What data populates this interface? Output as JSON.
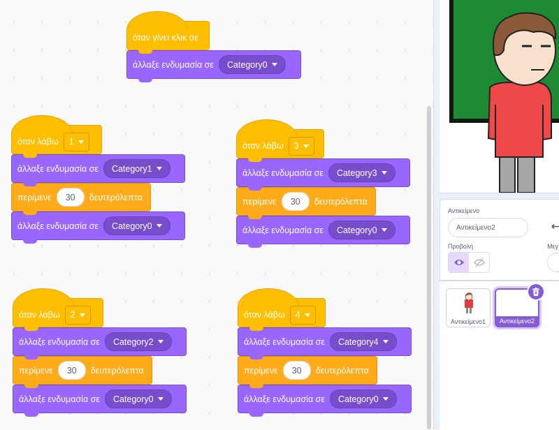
{
  "workspace": {
    "scripts": [
      {
        "hat": "όταν γίνει κλικ σε",
        "change_costume": "άλλαξε ενδυμασία σε",
        "costume": "Category0"
      },
      {
        "hat": "όταν λάβω",
        "message": "1",
        "change1": "άλλαξε ενδυμασία σε",
        "costume1": "Category1",
        "wait": "περίμενε",
        "seconds": "30",
        "seconds_label": "δευτερόλεπτα",
        "change2": "άλλαξε ενδυμασία σε",
        "costume2": "Category0"
      },
      {
        "hat": "όταν λάβω",
        "message": "3",
        "change1": "άλλαξε ενδυμασία σε",
        "costume1": "Category3",
        "wait": "περίμενε",
        "seconds": "30",
        "seconds_label": "δευτερόλεπτα",
        "change2": "άλλαξε ενδυμασία σε",
        "costume2": "Category0"
      },
      {
        "hat": "όταν λάβω",
        "message": "2",
        "change1": "άλλαξε ενδυμασία σε",
        "costume1": "Category2",
        "wait": "περίμενε",
        "seconds": "30",
        "seconds_label": "δευτερόλεπτα",
        "change2": "άλλαξε ενδυμασία σε",
        "costume2": "Category0"
      },
      {
        "hat": "όταν λάβω",
        "message": "4",
        "change1": "άλλαξε ενδυμασία σε",
        "costume1": "Category4",
        "wait": "περίμενε",
        "seconds": "30",
        "seconds_label": "δευτερόλεπτα",
        "change2": "άλλαξε ενδυμασία σε",
        "costume2": "Category0"
      }
    ]
  },
  "sprite_info": {
    "sprite_label": "Αντικείμενο",
    "sprite_name": "Αντικείμενο2",
    "show_label": "Προβολή",
    "size_label": "Μεγ"
  },
  "sprites": [
    {
      "name": "Αντικείμενο1"
    },
    {
      "name": "Αντικείμενο2"
    }
  ],
  "colors": {
    "events": "#ffbf00",
    "looks": "#9966ff",
    "control": "#ffab19",
    "selection": "#855cd6"
  }
}
